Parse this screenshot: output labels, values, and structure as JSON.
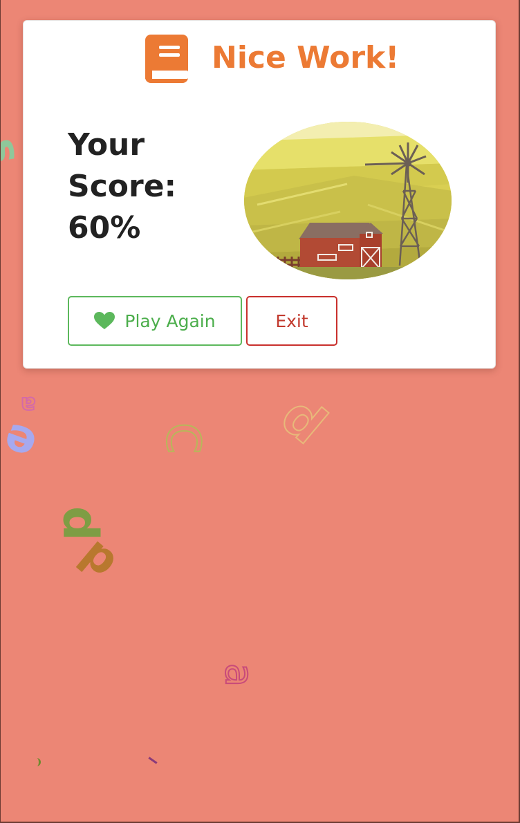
{
  "dialog": {
    "title": "Nice Work!",
    "score_lines": [
      "Your",
      "Score:",
      "60%"
    ],
    "illustration": "farm-barn-windmill-illustration",
    "icon": "book-icon"
  },
  "buttons": {
    "play_again_label": "Play Again",
    "play_again_icon": "heart-icon",
    "exit_label": "Exit"
  },
  "background": {
    "color": "#ec8675",
    "floating_letters": [
      "s",
      "a",
      "e",
      "c",
      "d",
      "p",
      "d",
      "a"
    ]
  },
  "colors": {
    "title": "#ec7a34",
    "play_again": "#5cb85c",
    "exit": "#c9302c",
    "score_text": "#222222"
  }
}
